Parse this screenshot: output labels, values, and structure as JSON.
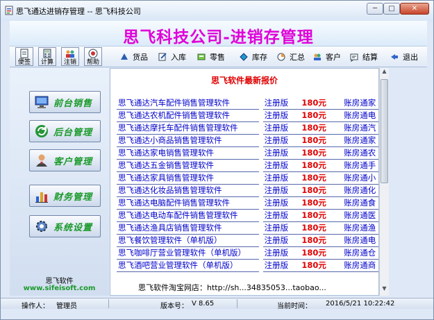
{
  "window": {
    "title": "思飞通达进销存管理 -- 思飞科技公司",
    "min_glyph": "─",
    "max_glyph": "□",
    "close_glyph": "✕"
  },
  "banner": {
    "title": "思飞科技公司-进销存管理"
  },
  "quick_buttons": [
    {
      "label": "便签",
      "icon": "notepad-icon"
    },
    {
      "label": "计算",
      "icon": "calculator-icon"
    },
    {
      "label": "注销",
      "icon": "logout-users-icon"
    },
    {
      "label": "帮助",
      "icon": "help-icon"
    }
  ],
  "toolbar": [
    {
      "label": "货品",
      "icon": "goods-icon"
    },
    {
      "label": "入库",
      "icon": "stock-in-icon"
    },
    {
      "label": "零售",
      "icon": "retail-icon"
    },
    {
      "label": "库存",
      "icon": "inventory-icon"
    },
    {
      "label": "汇总",
      "icon": "summary-icon"
    },
    {
      "label": "客户",
      "icon": "customer-icon"
    },
    {
      "label": "结算",
      "icon": "settlement-icon"
    },
    {
      "label": "退出",
      "icon": "exit-icon"
    }
  ],
  "sidebar": {
    "items": [
      {
        "label": "前台销售",
        "icon": "monitor-icon"
      },
      {
        "label": "后台管理",
        "icon": "refresh-icon"
      },
      {
        "label": "客户管理",
        "icon": "person-icon"
      },
      {
        "label": "财务管理",
        "icon": "bar-chart-icon"
      },
      {
        "label": "系统设置",
        "icon": "gear-icon"
      }
    ],
    "brand_name": "思飞软件",
    "brand_url": "www.sifeisoft.com"
  },
  "content": {
    "title": "思飞软件最新报价",
    "rows": [
      {
        "name": "思飞通达汽车配件销售管理软件",
        "type": "注册版",
        "price": "180元",
        "extra": "账房通家"
      },
      {
        "name": "思飞通达农机配件销售管理软件",
        "type": "注册版",
        "price": "180元",
        "extra": "账房通电"
      },
      {
        "name": "思飞通达摩托车配件销售管理软件",
        "type": "注册版",
        "price": "180元",
        "extra": "账房通汽"
      },
      {
        "name": "思飞通达小商品销售管理软件",
        "type": "注册版",
        "price": "180元",
        "extra": "账房通家"
      },
      {
        "name": "思飞通达家电销售管理软件",
        "type": "注册版",
        "price": "180元",
        "extra": "账房通农"
      },
      {
        "name": "思飞通达五金销售管理软件",
        "type": "注册版",
        "price": "180元",
        "extra": "账房通手"
      },
      {
        "name": "思飞通达家具销售管理软件",
        "type": "注册版",
        "price": "180元",
        "extra": "账房通小"
      },
      {
        "name": "思飞通达化妆品销售管理软件",
        "type": "注册版",
        "price": "180元",
        "extra": "账房通化"
      },
      {
        "name": "思飞通达电脑配件销售管理软件",
        "type": "注册版",
        "price": "180元",
        "extra": "账房通食"
      },
      {
        "name": "思飞通达电动车配件销售管理软件",
        "type": "注册版",
        "price": "180元",
        "extra": "账房通医"
      },
      {
        "name": "思飞通达渔具店销售管理软件",
        "type": "注册版",
        "price": "180元",
        "extra": "账房通渔"
      },
      {
        "name": "思飞餐饮管理软件（单机版）",
        "type": "注册版",
        "price": "180元",
        "extra": "账房通电"
      },
      {
        "name": "思飞咖啡厅营业管理软件（单机版）",
        "type": "注册版",
        "price": "180元",
        "extra": "账房通仓"
      },
      {
        "name": "思飞酒吧营业管理软件（单机版）",
        "type": "注册版",
        "price": "180元",
        "extra": "账房通商"
      }
    ],
    "footer": "思飞软件淘宝网店：http://sh...34835053...taobao..."
  },
  "status": {
    "operator_label": "操作人：",
    "operator_value": "管理员",
    "version_label": "版本号：",
    "version_value": "V 8.65",
    "time_label": "当前时间：",
    "time_value": "2016/5/21 10:22:42"
  }
}
